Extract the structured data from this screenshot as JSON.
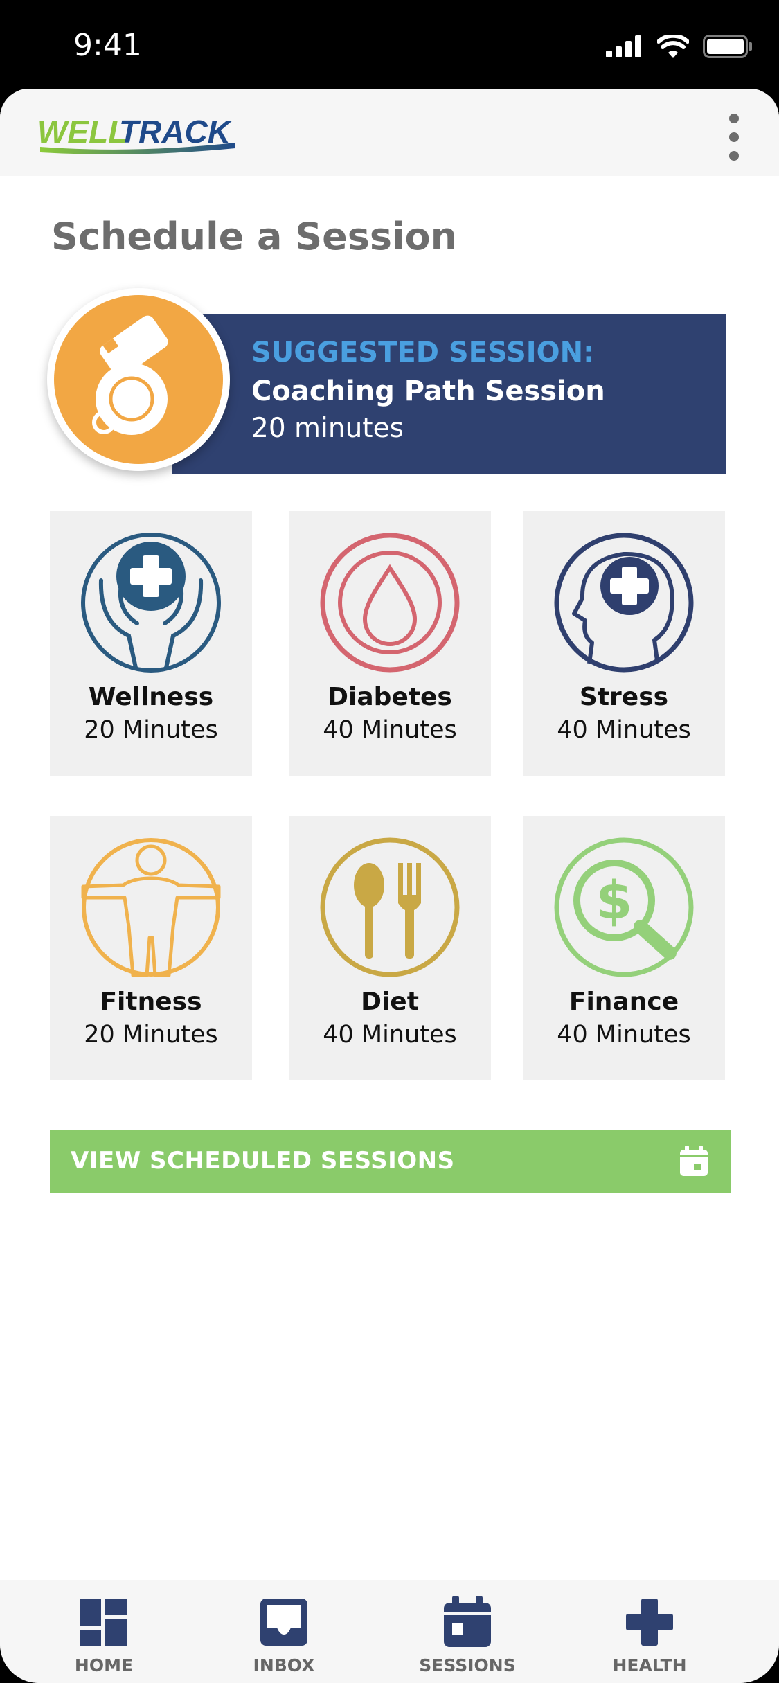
{
  "status_bar": {
    "time": "9:41"
  },
  "header": {
    "logo_text_part1": "WELL",
    "logo_text_part2": "TRACK",
    "menu_icon": "more-vertical-icon"
  },
  "page_title": "Schedule a Session",
  "suggested": {
    "label": "SUGGESTED SESSION:",
    "name": "Coaching Path Session",
    "duration": "20 minutes",
    "icon": "whistle-icon",
    "colors": {
      "banner": "#2f4170",
      "circle": "#f2a744",
      "label": "#4a9fe0"
    }
  },
  "tiles": [
    {
      "name": "Wellness",
      "duration": "20 Minutes",
      "icon": "hands-cross-icon",
      "color": "#2a5a80"
    },
    {
      "name": "Diabetes",
      "duration": "40 Minutes",
      "icon": "drop-icon",
      "color": "#d4656f"
    },
    {
      "name": "Stress",
      "duration": "40 Minutes",
      "icon": "head-cross-icon",
      "color": "#2f3f6e"
    },
    {
      "name": "Fitness",
      "duration": "20 Minutes",
      "icon": "body-icon",
      "color": "#f0b24d"
    },
    {
      "name": "Diet",
      "duration": "40 Minutes",
      "icon": "spoon-fork-icon",
      "color": "#c9a845"
    },
    {
      "name": "Finance",
      "duration": "40 Minutes",
      "icon": "dollar-search-icon",
      "color": "#94d07a"
    }
  ],
  "view_button": {
    "label": "VIEW SCHEDULED SESSIONS",
    "icon": "calendar-icon",
    "color": "#8acb6a"
  },
  "tabbar": [
    {
      "label": "HOME",
      "icon": "dashboard-icon"
    },
    {
      "label": "INBOX",
      "icon": "inbox-icon"
    },
    {
      "label": "SESSIONS",
      "icon": "calendar-icon"
    },
    {
      "label": "HEALTH",
      "icon": "plus-icon"
    }
  ],
  "brand_colors": {
    "navy": "#2f4170",
    "green": "#8acb6a",
    "grey_text": "#6d6d6d"
  }
}
